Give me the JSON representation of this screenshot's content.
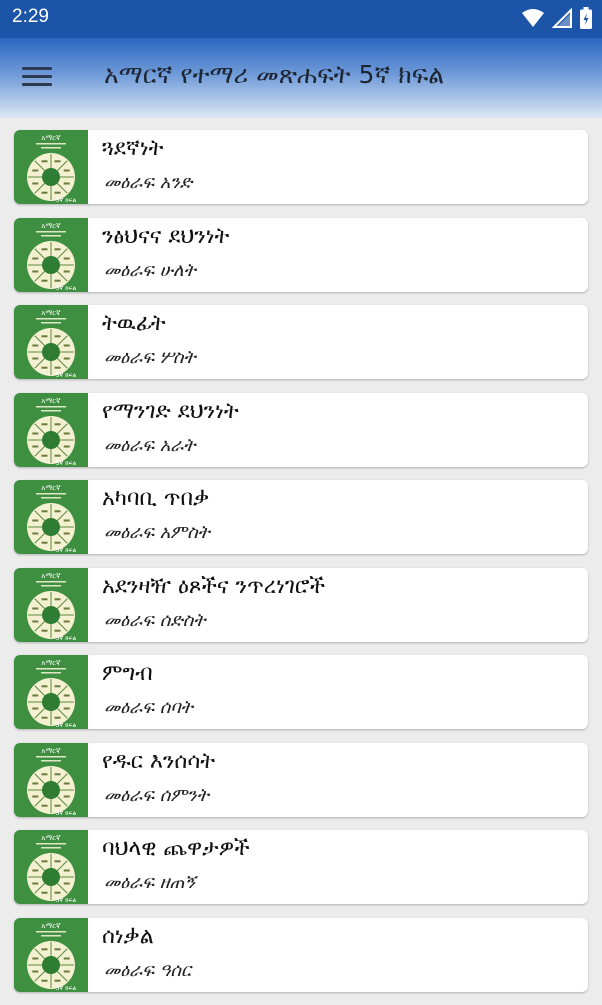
{
  "status_bar": {
    "time": "2:29"
  },
  "app_bar": {
    "title": "አማርኛ የተማሪ መጽሐፍት 5ኛ ክፍል"
  },
  "thumbnail": {
    "title_text": "አማርኛ",
    "grade_text": "5ኛ ክፍል",
    "bg_color": "#3f8f41",
    "wheel_color": "#f4f0d2",
    "center_color": "#2e7d32"
  },
  "chapters": [
    {
      "title": "ጓደኛነት",
      "subtitle": "መዕራፍ አንድ"
    },
    {
      "title": "ንፅህናና ደህንነት",
      "subtitle": "መዕራፍ ሁለት"
    },
    {
      "title": "ትዉፊት",
      "subtitle": "መዕራፍ ሦስት"
    },
    {
      "title": "የማንገድ ደህንነት",
      "subtitle": "መዕራፍ አራት"
    },
    {
      "title": "አካባቢ ጥበቃ",
      "subtitle": "መዕራፍ አምስት"
    },
    {
      "title": "አደንዛዥ ዕጾችና ንጥረነገሮች",
      "subtitle": "መዕራፍ ሰድስት"
    },
    {
      "title": "ምግብ",
      "subtitle": "መዕራፍ ሰባት"
    },
    {
      "title": "የዱር እንሰሳት",
      "subtitle": "መዕራፍ ሰምንት"
    },
    {
      "title": "ባህላዊ ጨዋታዎች",
      "subtitle": "መዕራፍ ዘጠኝ"
    },
    {
      "title": "ሰነቃል",
      "subtitle": "መዕራፍ ዓሰር"
    }
  ]
}
